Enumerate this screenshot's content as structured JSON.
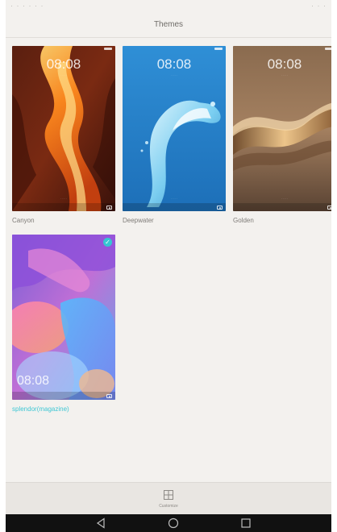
{
  "statusbar": {
    "left": "· · · · · ·",
    "right": "· · ·"
  },
  "header": {
    "title": "Themes"
  },
  "themes": [
    {
      "name": "Canyon",
      "clock": "08:08",
      "selected": false
    },
    {
      "name": "Deepwater",
      "clock": "08:08",
      "selected": false
    },
    {
      "name": "Golden",
      "clock": "08:08",
      "selected": false
    },
    {
      "name": "splendor(magazine)",
      "clock": "08:08",
      "selected": true,
      "check": "✓"
    }
  ],
  "bottom": {
    "customize_label": "Customize"
  },
  "icons": {
    "customize": "grid-icon",
    "back": "back-triangle-icon",
    "home": "home-circle-icon",
    "recents": "recents-square-icon",
    "selected": "check-icon"
  },
  "colors": {
    "accent": "#3ec7d4",
    "background": "#f3f1ee",
    "navbar": "#111111"
  }
}
